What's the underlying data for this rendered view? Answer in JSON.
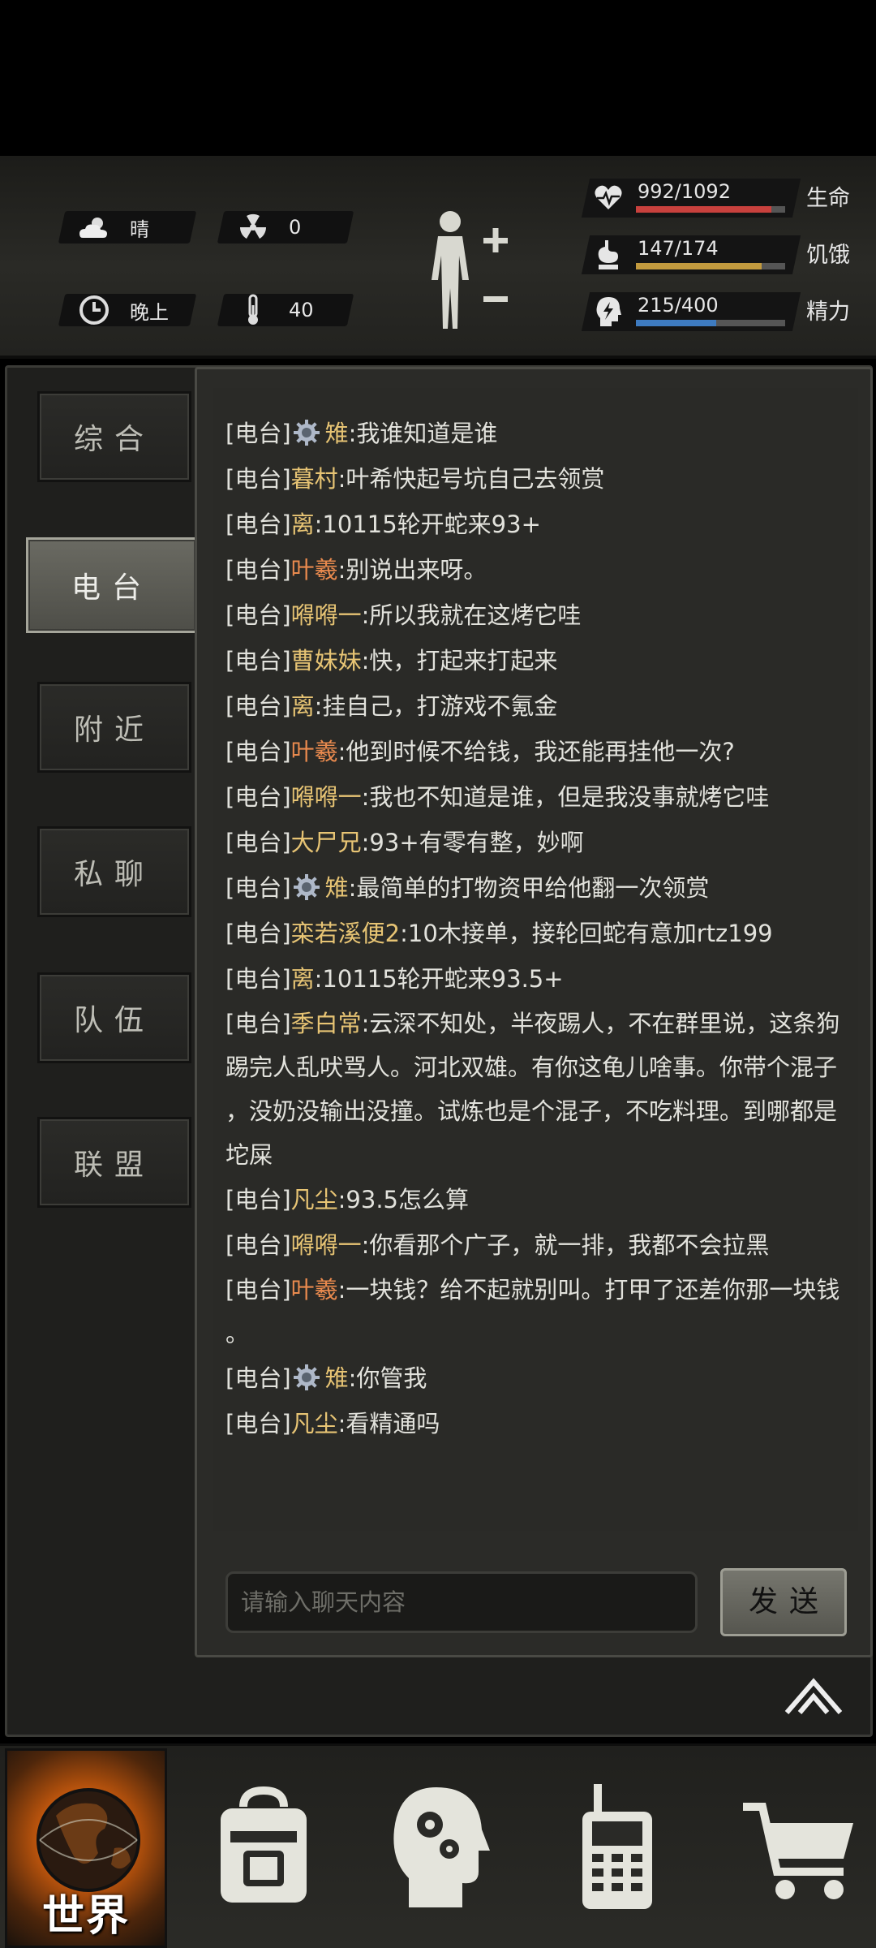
{
  "status": {
    "weather": "晴",
    "radiation": "0",
    "time_of_day": "晚上",
    "temperature": "40",
    "health": {
      "value": "992/1092",
      "label": "生命",
      "fraction": 0.909,
      "color": "#c8413d"
    },
    "hunger": {
      "value": "147/174",
      "label": "饥饿",
      "fraction": 0.845,
      "color": "#c29a3e"
    },
    "energy": {
      "value": "215/400",
      "label": "精力",
      "fraction": 0.5375,
      "color": "#3e7bc0"
    }
  },
  "tabs": [
    {
      "label": "综合",
      "active": false
    },
    {
      "label": "电台",
      "active": true
    },
    {
      "label": "附近",
      "active": false
    },
    {
      "label": "私聊",
      "active": false
    },
    {
      "label": "队伍",
      "active": false
    },
    {
      "label": "联盟",
      "active": false
    }
  ],
  "chat": {
    "messages": [
      {
        "channel": "[电台]",
        "gear": true,
        "name": "雉",
        "text": ":我谁知道是谁"
      },
      {
        "channel": "[电台]",
        "name": "暮村",
        "text": ":叶希快起号坑自己去领赏"
      },
      {
        "channel": "[电台]",
        "name": "离",
        "text": ":10115轮开蛇来93+"
      },
      {
        "channel": "[电台]",
        "name": "叶羲",
        "text": ":别说出来呀。"
      },
      {
        "channel": "[电台]",
        "name": "嘚嘚一",
        "text": ":所以我就在这烤它哇"
      },
      {
        "channel": "[电台]",
        "name": "曹妹妹",
        "text": ":快，打起来打起来"
      },
      {
        "channel": "[电台]",
        "name": "离",
        "text": ":挂自己，打游戏不氪金"
      },
      {
        "channel": "[电台]",
        "name": "叶羲",
        "text": ":他到时候不给钱，我还能再挂他一次?"
      },
      {
        "channel": "[电台]",
        "name": "嘚嘚一",
        "text": ":我也不知道是谁，但是我没事就烤它哇"
      },
      {
        "channel": "[电台]",
        "name": "大尸兄",
        "text": ":93+有零有整，妙啊"
      },
      {
        "channel": "[电台]",
        "gear": true,
        "name": "雉",
        "text": ":最简单的打物资甲给他翻一次领赏"
      },
      {
        "channel": "[电台]",
        "name": "栾若溪便2",
        "text": ":10木接单，接轮回蛇有意加rtz199"
      },
      {
        "channel": "[电台]",
        "name": "离",
        "text": ":10115轮开蛇来93.5+"
      },
      {
        "channel": "[电台]",
        "name": "季白常",
        "text": ":云深不知处，半夜踢人，不在群里说，这条狗",
        "cont": [
          "踢完人乱吠骂人。河北双雄。有你这龟儿啥事。你带个混子",
          "，没奶没输出没撞。试炼也是个混子，不吃料理。到哪都是",
          "坨屎"
        ]
      },
      {
        "channel": "[电台]",
        "name": "凡尘",
        "text": ":93.5怎么算"
      },
      {
        "channel": "[电台]",
        "name": "嘚嘚一",
        "text": ":你看那个广子，就一排，我都不会拉黑"
      },
      {
        "channel": "[电台]",
        "name": "叶羲",
        "text": ":一块钱？给不起就别叫。打甲了还差你那一块钱",
        "cont": [
          "。"
        ]
      },
      {
        "channel": "[电台]",
        "gear": true,
        "name": "雉",
        "text": ":你管我"
      },
      {
        "channel": "[电台]",
        "name": "凡尘",
        "text": ":看精通吗"
      }
    ],
    "input_placeholder": "请输入聊天内容",
    "send_label": "发送"
  },
  "nav": {
    "world_label": "世界"
  }
}
